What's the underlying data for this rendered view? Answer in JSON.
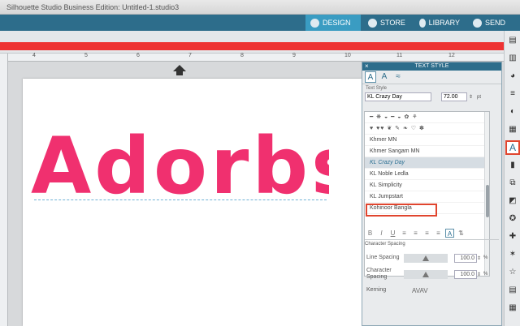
{
  "window": {
    "title": "Silhouette Studio Business Edition: Untitled-1.studio3"
  },
  "nav": {
    "design": "DESIGN",
    "store": "STORE",
    "library": "LIBRARY",
    "send": "SEND"
  },
  "ruler": {
    "numbers": [
      "4",
      "5",
      "6",
      "7",
      "8",
      "9",
      "10",
      "11",
      "12"
    ]
  },
  "canvas": {
    "text": "Adorbs",
    "text_color": "#f0306f"
  },
  "panel": {
    "title": "TEXT STYLE",
    "section_label": "Text Style",
    "font_name": "KL Crazy Day",
    "font_size": "72.00",
    "size_unit": "pt",
    "fonts": [
      "Khmer MN",
      "Khmer Sangam MN",
      "KL Crazy Day",
      "KL Noble Ledla",
      "KL Simplicity",
      "KL Jumpstart",
      "Kohinoor Bangla"
    ],
    "selected_font": "KL Crazy Day",
    "format": [
      "B",
      "I",
      "U"
    ],
    "char_spacing_label": "Character Spacing",
    "line_spacing_label": "Line Spacing",
    "line_spacing_value": "100.0",
    "char_spacing_row_label": "Character Spacing",
    "char_spacing_value": "100.0",
    "percent": "%",
    "kerning_label": "Kerning",
    "kerning_glyph": "AVAV"
  },
  "colors": {
    "accent": "#2d6d8b",
    "highlight": "#e0452e"
  }
}
